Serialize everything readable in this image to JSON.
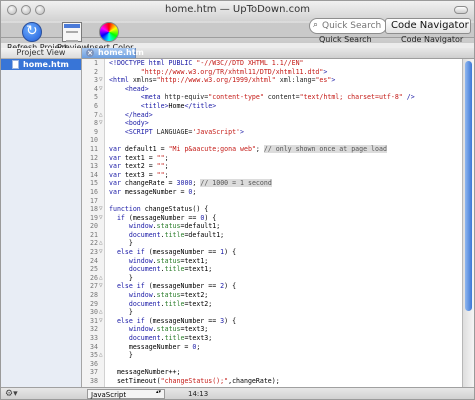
{
  "window": {
    "title": "home.htm — UpToDown.com"
  },
  "toolbar": {
    "refresh_label": "Refresh Project",
    "preview_label": "Preview",
    "insert_color_label": "Insert Color",
    "search_placeholder": "Quick Search",
    "search_label": "Quick Search",
    "code_navigator_value": "Code Navigator",
    "code_navigator_label": "Code Navigator"
  },
  "sidebar": {
    "header": "Project View",
    "items": [
      {
        "label": "home.htm"
      }
    ]
  },
  "tabs": [
    {
      "label": "home.htm"
    }
  ],
  "editor": {
    "lines": [
      {
        "n": "1",
        "fold": "",
        "tokens": [
          {
            "t": "<!DOCTYPE html PUBLIC ",
            "c": "tag"
          },
          {
            "t": "\"-//W3C//DTD XHTML 1.1//EN\"",
            "c": "str"
          }
        ]
      },
      {
        "n": "2",
        "fold": "",
        "tokens": [
          {
            "t": "        \"http://www.w3.org/TR/xhtml11/DTD/xhtml11.dtd\"",
            "c": "str"
          },
          {
            "t": ">",
            "c": "tag"
          }
        ]
      },
      {
        "n": "3",
        "fold": "▽",
        "tokens": [
          {
            "t": "<html ",
            "c": "tag"
          },
          {
            "t": "xmlns=",
            "c": "attr"
          },
          {
            "t": "\"http://www.w3.org/1999/xhtml\"",
            "c": "str"
          },
          {
            "t": " xml:lang=",
            "c": "attr"
          },
          {
            "t": "\"es\"",
            "c": "str"
          },
          {
            "t": ">",
            "c": "tag"
          }
        ]
      },
      {
        "n": "4",
        "fold": "▽",
        "tokens": [
          {
            "t": "    <head>",
            "c": "tag"
          }
        ]
      },
      {
        "n": "5",
        "fold": "",
        "tokens": [
          {
            "t": "        <meta ",
            "c": "tag"
          },
          {
            "t": "http-equiv=",
            "c": "attr"
          },
          {
            "t": "\"content-type\"",
            "c": "str"
          },
          {
            "t": " content=",
            "c": "attr"
          },
          {
            "t": "\"text/html; charset=utf-8\"",
            "c": "str"
          },
          {
            "t": " />",
            "c": "tag"
          }
        ]
      },
      {
        "n": "6",
        "fold": "",
        "tokens": [
          {
            "t": "        <title>",
            "c": "tag"
          },
          {
            "t": "Home",
            "c": "plain"
          },
          {
            "t": "</title>",
            "c": "tag"
          }
        ]
      },
      {
        "n": "7",
        "fold": "△",
        "tokens": [
          {
            "t": "    </head>",
            "c": "tag"
          }
        ]
      },
      {
        "n": "8",
        "fold": "▽",
        "tokens": [
          {
            "t": "    <body>",
            "c": "tag"
          }
        ]
      },
      {
        "n": "9",
        "fold": "",
        "tokens": [
          {
            "t": "    <SCRIPT ",
            "c": "tag"
          },
          {
            "t": "LANGUAGE=",
            "c": "attr"
          },
          {
            "t": "'JavaScript'",
            "c": "str"
          },
          {
            "t": ">",
            "c": "tag"
          }
        ]
      },
      {
        "n": "10",
        "fold": "",
        "tokens": []
      },
      {
        "n": "11",
        "fold": "",
        "tokens": [
          {
            "t": "var",
            "c": "kw"
          },
          {
            "t": " default1 = ",
            "c": "plain"
          },
          {
            "t": "\"Mi p&aacute;gona web\"",
            "c": "str"
          },
          {
            "t": "; ",
            "c": "plain"
          },
          {
            "t": "// only shown once at page load",
            "c": "cm"
          }
        ]
      },
      {
        "n": "12",
        "fold": "",
        "tokens": [
          {
            "t": "var",
            "c": "kw"
          },
          {
            "t": " text1 = ",
            "c": "plain"
          },
          {
            "t": "\"\"",
            "c": "str"
          },
          {
            "t": ";",
            "c": "plain"
          }
        ]
      },
      {
        "n": "13",
        "fold": "",
        "tokens": [
          {
            "t": "var",
            "c": "kw"
          },
          {
            "t": " text2 = ",
            "c": "plain"
          },
          {
            "t": "\"\"",
            "c": "str"
          },
          {
            "t": ";",
            "c": "plain"
          }
        ]
      },
      {
        "n": "14",
        "fold": "",
        "tokens": [
          {
            "t": "var",
            "c": "kw"
          },
          {
            "t": " text3 = ",
            "c": "plain"
          },
          {
            "t": "\"\"",
            "c": "str"
          },
          {
            "t": ";",
            "c": "plain"
          }
        ]
      },
      {
        "n": "15",
        "fold": "",
        "tokens": [
          {
            "t": "var",
            "c": "kw"
          },
          {
            "t": " changeRate = ",
            "c": "plain"
          },
          {
            "t": "3000",
            "c": "num"
          },
          {
            "t": "; ",
            "c": "plain"
          },
          {
            "t": "// 1000 = 1 second",
            "c": "cm"
          }
        ]
      },
      {
        "n": "16",
        "fold": "",
        "tokens": [
          {
            "t": "var",
            "c": "kw"
          },
          {
            "t": " messageNumber = ",
            "c": "plain"
          },
          {
            "t": "0",
            "c": "num"
          },
          {
            "t": ";",
            "c": "plain"
          }
        ]
      },
      {
        "n": "17",
        "fold": "",
        "tokens": []
      },
      {
        "n": "18",
        "fold": "▽",
        "tokens": [
          {
            "t": "function",
            "c": "kw"
          },
          {
            "t": " changeStatus() {",
            "c": "plain"
          }
        ]
      },
      {
        "n": "19",
        "fold": "▽",
        "tokens": [
          {
            "t": "  if",
            "c": "kw"
          },
          {
            "t": " (messageNumber == ",
            "c": "plain"
          },
          {
            "t": "0",
            "c": "num"
          },
          {
            "t": ") {",
            "c": "plain"
          }
        ]
      },
      {
        "n": "20",
        "fold": "",
        "tokens": [
          {
            "t": "     window",
            "c": "var"
          },
          {
            "t": ".",
            "c": "plain"
          },
          {
            "t": "status",
            "c": "prop"
          },
          {
            "t": "=default1;",
            "c": "plain"
          }
        ]
      },
      {
        "n": "21",
        "fold": "",
        "tokens": [
          {
            "t": "     document",
            "c": "var"
          },
          {
            "t": ".",
            "c": "plain"
          },
          {
            "t": "title",
            "c": "prop"
          },
          {
            "t": "=default1;",
            "c": "plain"
          }
        ]
      },
      {
        "n": "22",
        "fold": "△",
        "tokens": [
          {
            "t": "     }",
            "c": "plain"
          }
        ]
      },
      {
        "n": "23",
        "fold": "▽",
        "tokens": [
          {
            "t": "  else if",
            "c": "kw"
          },
          {
            "t": " (messageNumber == ",
            "c": "plain"
          },
          {
            "t": "1",
            "c": "num"
          },
          {
            "t": ") {",
            "c": "plain"
          }
        ]
      },
      {
        "n": "24",
        "fold": "",
        "tokens": [
          {
            "t": "     window",
            "c": "var"
          },
          {
            "t": ".",
            "c": "plain"
          },
          {
            "t": "status",
            "c": "prop"
          },
          {
            "t": "=text1;",
            "c": "plain"
          }
        ]
      },
      {
        "n": "25",
        "fold": "",
        "tokens": [
          {
            "t": "     document",
            "c": "var"
          },
          {
            "t": ".",
            "c": "plain"
          },
          {
            "t": "title",
            "c": "prop"
          },
          {
            "t": "=text1;",
            "c": "plain"
          }
        ]
      },
      {
        "n": "26",
        "fold": "△",
        "tokens": [
          {
            "t": "     }",
            "c": "plain"
          }
        ]
      },
      {
        "n": "27",
        "fold": "▽",
        "tokens": [
          {
            "t": "  else if",
            "c": "kw"
          },
          {
            "t": " (messageNumber == ",
            "c": "plain"
          },
          {
            "t": "2",
            "c": "num"
          },
          {
            "t": ") {",
            "c": "plain"
          }
        ]
      },
      {
        "n": "28",
        "fold": "",
        "tokens": [
          {
            "t": "     window",
            "c": "var"
          },
          {
            "t": ".",
            "c": "plain"
          },
          {
            "t": "status",
            "c": "prop"
          },
          {
            "t": "=text2;",
            "c": "plain"
          }
        ]
      },
      {
        "n": "29",
        "fold": "",
        "tokens": [
          {
            "t": "     document",
            "c": "var"
          },
          {
            "t": ".",
            "c": "plain"
          },
          {
            "t": "title",
            "c": "prop"
          },
          {
            "t": "=text2;",
            "c": "plain"
          }
        ]
      },
      {
        "n": "30",
        "fold": "△",
        "tokens": [
          {
            "t": "     }",
            "c": "plain"
          }
        ]
      },
      {
        "n": "31",
        "fold": "▽",
        "tokens": [
          {
            "t": "  else if",
            "c": "kw"
          },
          {
            "t": " (messageNumber == ",
            "c": "plain"
          },
          {
            "t": "3",
            "c": "num"
          },
          {
            "t": ") {",
            "c": "plain"
          }
        ]
      },
      {
        "n": "32",
        "fold": "",
        "tokens": [
          {
            "t": "     window",
            "c": "var"
          },
          {
            "t": ".",
            "c": "plain"
          },
          {
            "t": "status",
            "c": "prop"
          },
          {
            "t": "=text3;",
            "c": "plain"
          }
        ]
      },
      {
        "n": "33",
        "fold": "",
        "tokens": [
          {
            "t": "     document",
            "c": "var"
          },
          {
            "t": ".",
            "c": "plain"
          },
          {
            "t": "title",
            "c": "prop"
          },
          {
            "t": "=text3;",
            "c": "plain"
          }
        ]
      },
      {
        "n": "34",
        "fold": "",
        "tokens": [
          {
            "t": "     messageNumber = ",
            "c": "plain"
          },
          {
            "t": "0",
            "c": "num"
          },
          {
            "t": ";",
            "c": "plain"
          }
        ]
      },
      {
        "n": "35",
        "fold": "△",
        "tokens": [
          {
            "t": "     }",
            "c": "plain"
          }
        ]
      },
      {
        "n": "36",
        "fold": "",
        "tokens": []
      },
      {
        "n": "37",
        "fold": "",
        "tokens": [
          {
            "t": "  messageNumber++;",
            "c": "plain"
          }
        ]
      },
      {
        "n": "38",
        "fold": "",
        "tokens": [
          {
            "t": "  setTimeout(",
            "c": "plain"
          },
          {
            "t": "\"changeStatus();\"",
            "c": "str"
          },
          {
            "t": ",changeRate);",
            "c": "plain"
          }
        ]
      }
    ]
  },
  "statusbar": {
    "gear_glyph": "⚙▾",
    "language": "JavaScript",
    "position": "14:13"
  },
  "colors": {
    "selection": "#3875d7",
    "tag": "#1a1aa6",
    "string": "#c41a16",
    "property": "#2a7d2a",
    "comment_bg": "#dcdcdc"
  }
}
